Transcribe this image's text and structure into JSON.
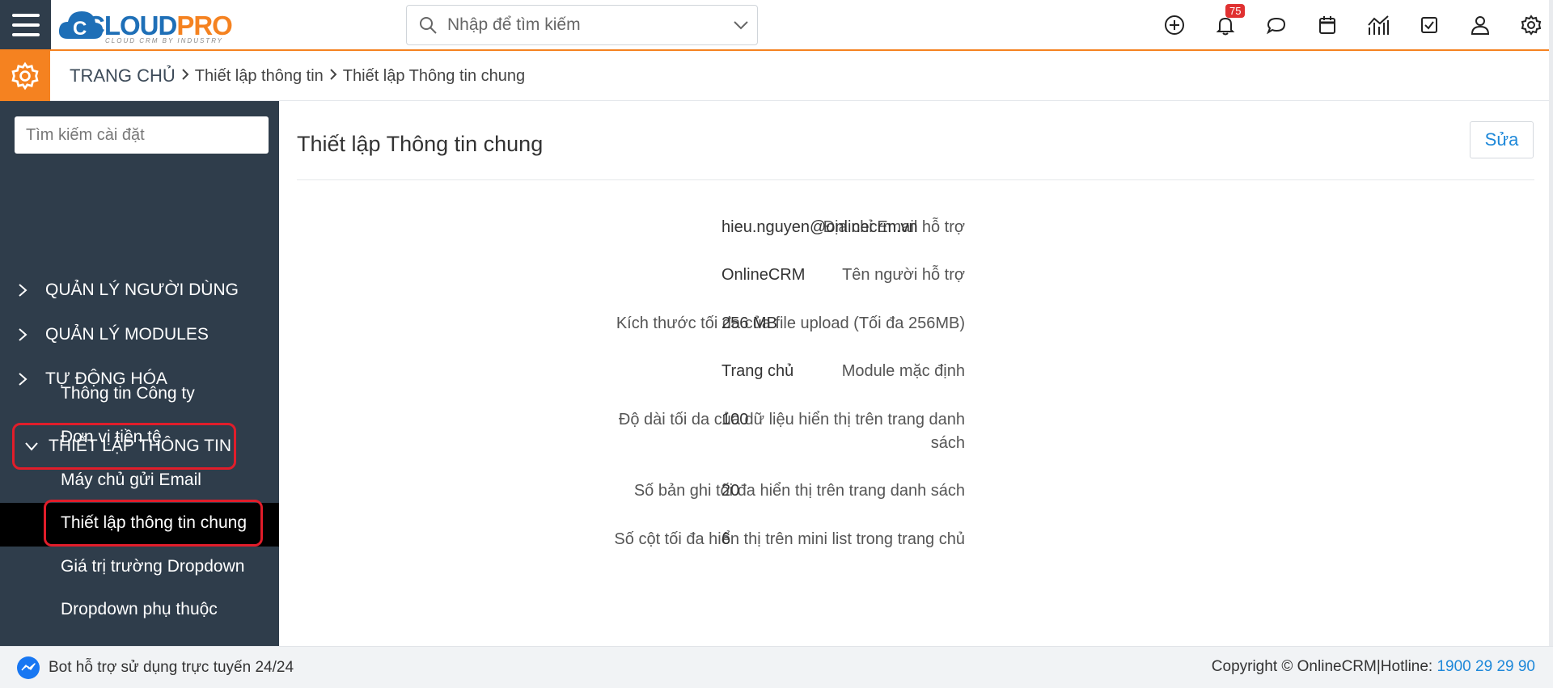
{
  "header": {
    "logo": {
      "main_a": "CLOUD",
      "main_b": "PRO",
      "tagline": "CLOUD CRM BY INDUSTRY"
    },
    "search_placeholder": "Nhập để tìm kiếm",
    "notification_count": "75",
    "icons": [
      "plus-circle-icon",
      "bell-icon",
      "chat-icon",
      "calendar-icon",
      "report-chart-icon",
      "task-check-icon",
      "user-icon",
      "gear-icon"
    ]
  },
  "breadcrumb": {
    "home": "TRANG CHỦ",
    "level1": "Thiết lập thông tin",
    "level2": "Thiết lập Thông tin chung"
  },
  "sidebar": {
    "search_placeholder": "Tìm kiếm cài đặt",
    "sections": [
      {
        "label": "QUẢN LÝ NGƯỜI DÙNG"
      },
      {
        "label": "QUẢN LÝ MODULES"
      },
      {
        "label": "TỰ ĐỘNG HÓA"
      },
      {
        "label": "THIẾT LẬP THÔNG TIN"
      }
    ],
    "subitems": [
      {
        "label": "Thông tin Công ty"
      },
      {
        "label": "Đơn vị tiền tệ"
      },
      {
        "label": "Máy chủ gửi Email"
      },
      {
        "label": "Thiết lập thông tin chung"
      },
      {
        "label": "Giá trị trường Dropdown"
      },
      {
        "label": "Dropdown phụ thuộc"
      }
    ]
  },
  "main": {
    "title": "Thiết lập Thông tin chung",
    "edit_label": "Sửa",
    "fields": [
      {
        "label": "Địa chỉ Email hỗ trợ",
        "value": "hieu.nguyen@onlinecrm.vn"
      },
      {
        "label": "Tên người hỗ trợ",
        "value": "OnlineCRM"
      },
      {
        "label": "Kích thước tối đa của file upload (Tối đa 256MB)",
        "value": "256 MB"
      },
      {
        "label": "Module mặc định",
        "value": "Trang chủ"
      },
      {
        "label_line1": "Độ dài tối da của dữ liệu hiển thị trên trang danh",
        "label_line2": "sách",
        "value": "100"
      },
      {
        "label": "Số bản ghi tối đa hiển thị trên trang danh sách",
        "value": "20"
      },
      {
        "label": "Số cột tối đa hiển thị trên mini list trong trang chủ",
        "value": "6"
      }
    ]
  },
  "footer": {
    "bot_text": "Bot hỗ trợ sử dụng trực tuyến 24/24",
    "copyright": "Copyright © OnlineCRM|Hotline: ",
    "hotline": "1900 29 29 90"
  },
  "colors": {
    "accent": "#f58220",
    "sidebar_bg": "#2f3d4b",
    "highlight_border": "#e11d2a",
    "link": "#1e88d9"
  }
}
